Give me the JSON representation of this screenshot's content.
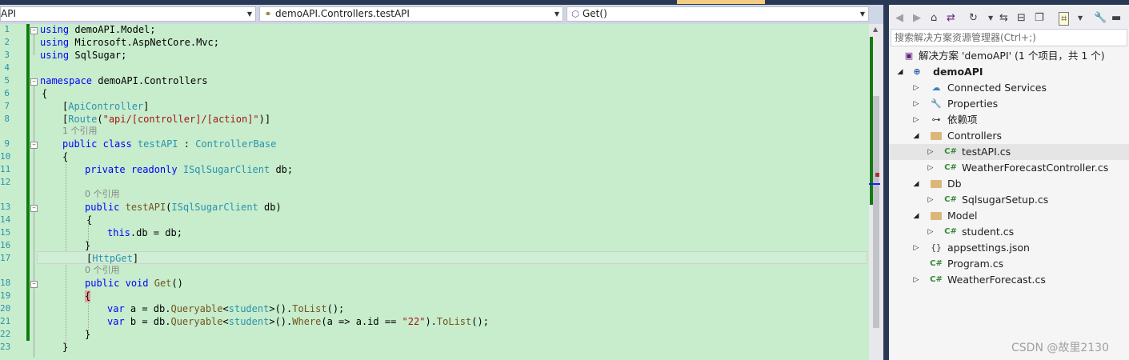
{
  "navbar": {
    "project_combo": "API",
    "class_combo": "demoAPI.Controllers.testAPI",
    "member_combo": "Get()"
  },
  "editor": {
    "line_numbers": [
      "1",
      "2",
      "3",
      "4",
      "5",
      "6",
      "7",
      "8",
      "9",
      "10",
      "11",
      "12",
      "13",
      "14",
      "15",
      "16",
      "17",
      "18",
      "19",
      "20",
      "21",
      "22",
      "23"
    ],
    "lines": {
      "l1": {
        "kw": "using",
        "rest": " demoAPI.Model;"
      },
      "l2": {
        "kw": "using",
        "rest": " Microsoft.AspNetCore.Mvc;"
      },
      "l3": {
        "kw": "using",
        "rest": " SqlSugar;"
      },
      "l5": {
        "kw": "namespace",
        "rest": " demoAPI.Controllers"
      },
      "l6": "{",
      "l7": {
        "open": "[",
        "attr": "ApiController",
        "close": "]"
      },
      "l8": {
        "open": "[",
        "attr": "Route",
        "mid": "(",
        "str": "\"api/[controller]/[action]\"",
        "close": ")]"
      },
      "l9": {
        "kw1": "public",
        "kw2": "class",
        "name": "testAPI",
        "sep": " : ",
        "base": "ControllerBase"
      },
      "l10": "{",
      "l11": {
        "kw1": "private",
        "kw2": "readonly",
        "type": "ISqlSugarClient",
        "rest": " db;"
      },
      "l13": {
        "kw": "public",
        "name": "testAPI",
        "open": "(",
        "type": "ISqlSugarClient",
        "rest": " db)"
      },
      "l14": "{",
      "l15": {
        "kw": "this",
        "rest": ".db = db;"
      },
      "l16": "}",
      "l17": {
        "open": "[",
        "attr": "HttpGet",
        "close": "]"
      },
      "l18": {
        "kw1": "public",
        "kw2": "void",
        "name": "Get",
        "rest": "()"
      },
      "l19": "{",
      "l20": {
        "kw": "var",
        "a": " a = db.",
        "m1": "Queryable",
        "lt": "<",
        "type": "student",
        "gt": ">",
        "b": "().",
        "m2": "ToList",
        "c": "();"
      },
      "l21": {
        "kw": "var",
        "a": " b = db.",
        "m1": "Queryable",
        "lt": "<",
        "type": "student",
        "gt": ">",
        "b": "().",
        "m2": "Where",
        "c": "(a => a.id == ",
        "str": "\"22\"",
        "d": ").",
        "m3": "ToList",
        "e": "();"
      },
      "l22": "}",
      "l23": "}"
    },
    "lens_1_ref": "1 个引用",
    "lens_0_ref_a": "0 个引用",
    "lens_0_ref_b": "0 个引用"
  },
  "solution_explorer": {
    "search_placeholder": "搜索解决方案资源管理器(Ctrl+;)",
    "items": [
      {
        "label": "解决方案 'demoAPI' (1 个项目，共 1 个)",
        "icon": "solution-icon"
      },
      {
        "label": "demoAPI",
        "icon": "csharp-project-icon"
      },
      {
        "label": "Connected Services",
        "icon": "connected-services-icon"
      },
      {
        "label": "Properties",
        "icon": "properties-icon"
      },
      {
        "label": "依赖项",
        "icon": "dependencies-icon"
      },
      {
        "label": "Controllers",
        "icon": "folder-icon"
      },
      {
        "label": "testAPI.cs",
        "icon": "csharp-file-icon"
      },
      {
        "label": "WeatherForecastController.cs",
        "icon": "csharp-file-icon"
      },
      {
        "label": "Db",
        "icon": "folder-icon"
      },
      {
        "label": "SqlsugarSetup.cs",
        "icon": "csharp-file-icon"
      },
      {
        "label": "Model",
        "icon": "folder-icon"
      },
      {
        "label": "student.cs",
        "icon": "csharp-file-icon"
      },
      {
        "label": "appsettings.json",
        "icon": "json-file-icon"
      },
      {
        "label": "Program.cs",
        "icon": "csharp-file-icon"
      },
      {
        "label": "WeatherForecast.cs",
        "icon": "csharp-file-icon"
      }
    ],
    "cs_glyph": "C#"
  },
  "watermark": "CSDN @故里2130"
}
